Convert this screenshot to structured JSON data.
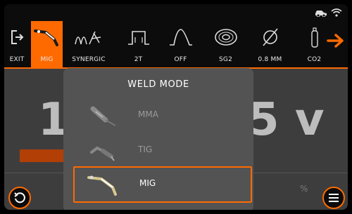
{
  "colors": {
    "accent": "#ff6a00",
    "bar": "#b23f06",
    "toolbar_bg": "#0c0c0c"
  },
  "statusbar": {
    "icons": [
      "vehicle-icon",
      "wifi-icon"
    ]
  },
  "toolbar": {
    "items": [
      {
        "label": "EXIT",
        "icon": "exit-icon"
      },
      {
        "label": "MIG",
        "icon": "mig-torch-icon",
        "active": true
      },
      {
        "label": "SYNERGIC",
        "icon": "synergic-icon"
      },
      {
        "label": "2T",
        "icon": "trigger-2t-icon"
      },
      {
        "label": "OFF",
        "icon": "slope-icon"
      },
      {
        "label": "SG2",
        "icon": "wire-spool-icon"
      },
      {
        "label": "0.8 MM",
        "icon": "diameter-icon"
      },
      {
        "label": "CO2",
        "icon": "gas-cylinder-icon"
      }
    ],
    "next_icon": "arrow-right-icon"
  },
  "background": {
    "left_value": "1",
    "right_value": "5 v",
    "percent_sign": "%"
  },
  "modal": {
    "title": "WELD MODE",
    "modes": [
      {
        "label": "MMA",
        "icon": "mma-electrode-icon",
        "state": "disabled"
      },
      {
        "label": "TIG",
        "icon": "tig-torch-icon",
        "state": "disabled"
      },
      {
        "label": "MIG",
        "icon": "mig-torch-icon",
        "state": "selected"
      }
    ]
  },
  "buttons": {
    "back_icon": "undo-icon",
    "menu_icon": "menu-icon"
  }
}
